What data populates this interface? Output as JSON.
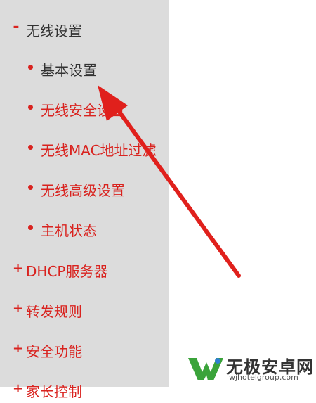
{
  "colors": {
    "accent": "#d9231f",
    "sidebar_bg": "#dcdcdc",
    "text_dark": "#333333"
  },
  "menu": {
    "wireless": {
      "expander": "-",
      "label": "无线设置",
      "items": [
        {
          "label": "基本设置",
          "active": true
        },
        {
          "label": "无线安全设置",
          "active": false
        },
        {
          "label": "无线MAC地址过滤",
          "active": false
        },
        {
          "label": "无线高级设置",
          "active": false
        },
        {
          "label": "主机状态",
          "active": false
        }
      ]
    },
    "groups": [
      {
        "expander": "+",
        "label": "DHCP服务器"
      },
      {
        "expander": "+",
        "label": "转发规则"
      },
      {
        "expander": "+",
        "label": "安全功能"
      },
      {
        "expander": "+",
        "label": "家长控制"
      }
    ]
  },
  "annotation": {
    "icon": "red-arrow-icon",
    "points_to": "基本设置"
  },
  "watermark": {
    "icon": "wj-logo-icon",
    "text": "无极安卓网",
    "url": "wjhotelgroup.com"
  }
}
